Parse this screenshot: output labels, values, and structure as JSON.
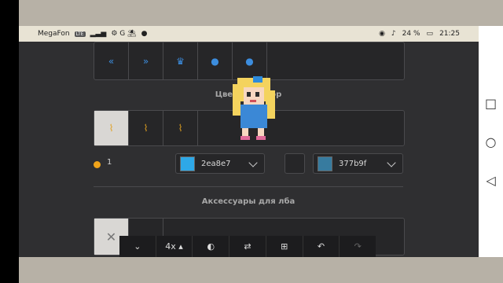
{
  "status": {
    "carrier": "MegaFon",
    "lte": "LTE",
    "notif_icons": "⚙ G ⛱",
    "battery": "24 %",
    "time": "21:25"
  },
  "editor": {
    "top_row": [
      "«",
      "»",
      "♛",
      "●",
      "●"
    ],
    "section1_title": "Цвета и декор",
    "bow_row": [
      "⌇",
      "⌇",
      "⌇"
    ],
    "color": {
      "index": "1",
      "color1": "2ea8e7",
      "color2": "377b9f",
      "swatch1": "#2ea8e7",
      "swatch2": "#377b9f",
      "dot": "#f0a41a"
    },
    "section2_title": "Аксессуары для лба",
    "accessory_x": "✕",
    "toolbar": {
      "zoom": "4x"
    }
  }
}
